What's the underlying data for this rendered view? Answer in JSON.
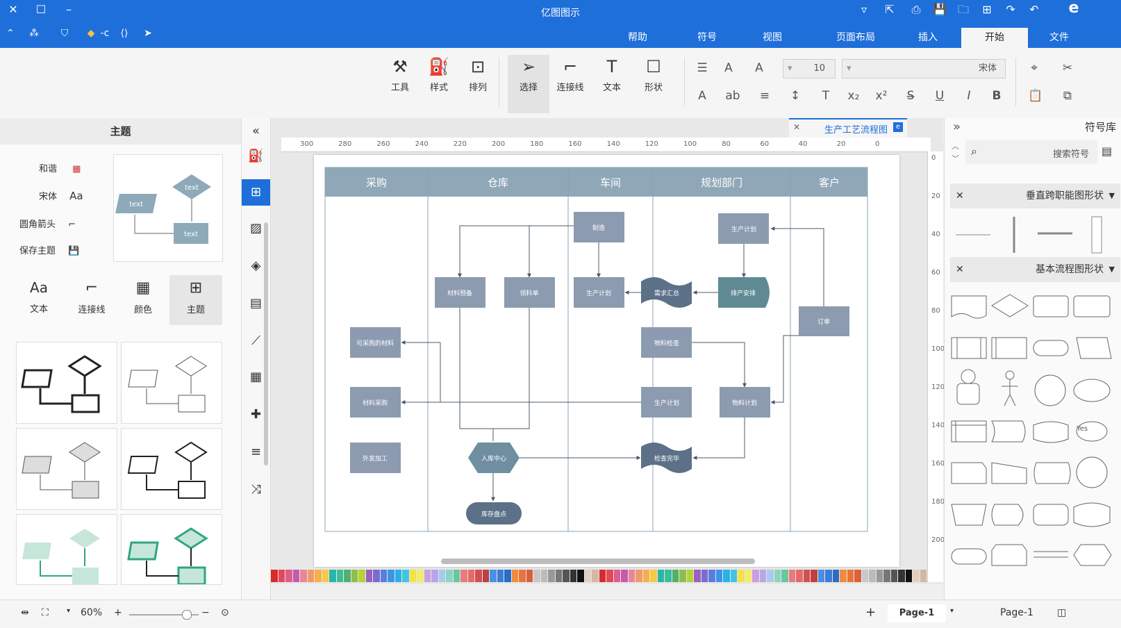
{
  "window": {
    "title": "亿图图示"
  },
  "menu_tabs": [
    "文件",
    "开始",
    "插入",
    "页面布局",
    "视图",
    "符号",
    "帮助"
  ],
  "active_tab": "开始",
  "ribbon": {
    "font_name": "宋体",
    "font_size": "10",
    "buttons": {
      "shape": "形状",
      "text": "文本",
      "connector": "连接线",
      "select": "选择",
      "arrange": "排列",
      "style": "样式",
      "tools": "工具"
    }
  },
  "left_panel": {
    "title": "主题",
    "options": [
      "和谐",
      "宋体",
      "圆角箭头",
      "保存主题"
    ],
    "tabs": [
      "主题",
      "颜色",
      "连接线",
      "文本"
    ],
    "active_tab": "主题",
    "preview_texts": [
      "text",
      "text",
      "text"
    ],
    "text_icon": "Aa"
  },
  "document": {
    "tab_label": "生产工艺流程图"
  },
  "rulers": {
    "top": [
      "0",
      "20",
      "40",
      "60",
      "80",
      "100",
      "120",
      "140",
      "160",
      "180",
      "200",
      "220",
      "240",
      "260",
      "280",
      "300"
    ],
    "right": [
      "0",
      "20",
      "40",
      "60",
      "80",
      "100",
      "120",
      "140",
      "160",
      "180",
      "200"
    ]
  },
  "diagram": {
    "lanes": [
      "客户",
      "规划部门",
      "车间",
      "仓库",
      "采购"
    ],
    "nodes": {
      "order": "订单",
      "plan": "生产计划",
      "schedule": "排产安排",
      "material_plan": "物料计划",
      "production_plan": "生产计划",
      "req_collect": "需求汇总",
      "material_check": "物料检查",
      "make": "制造",
      "production": "生产计划",
      "collect_material": "领料单",
      "material_prep": "材料预备",
      "material_trans": "材料采购",
      "purchase_check": "可采购的材料",
      "warehouse_in": "入库中心",
      "outsource": "外发加工",
      "buy": "材料采购",
      "pre_check": "检查完毕",
      "warehouse_done": "库存盘点",
      "stock": "库存盘点"
    }
  },
  "right_panel": {
    "title": "符号库",
    "search_placeholder": "搜索符号",
    "sections": [
      "垂直跨职能图形状",
      "基本流程图形状"
    ],
    "yes_label": "Yes"
  },
  "status": {
    "page_selector": "Page-1",
    "page_tab": "Page-1",
    "zoom": "60%"
  },
  "colors": {
    "accent": "#1e6fd9",
    "lane_header": "#8fa7b7",
    "node": "#8c9bb0",
    "node_dark": "#5c7087",
    "teal": "#5f8a93"
  }
}
